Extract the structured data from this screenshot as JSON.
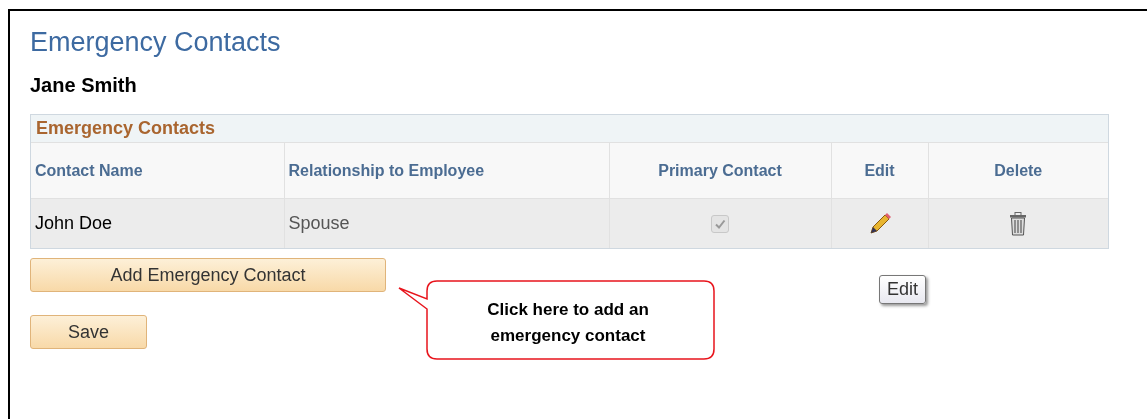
{
  "page_title": "Emergency Contacts",
  "employee_name": "Jane Smith",
  "grid": {
    "title": "Emergency Contacts",
    "columns": [
      "Contact Name",
      "Relationship to Employee",
      "Primary Contact",
      "Edit",
      "Delete"
    ],
    "rows": [
      {
        "contact_name": "John Doe",
        "relationship": "Spouse",
        "primary_contact": {
          "checked": true,
          "disabled": true
        }
      }
    ]
  },
  "buttons": [
    "Add Emergency Contact",
    "Save"
  ],
  "tooltip": "Edit",
  "callout": "Click here to add an emergency contact"
}
